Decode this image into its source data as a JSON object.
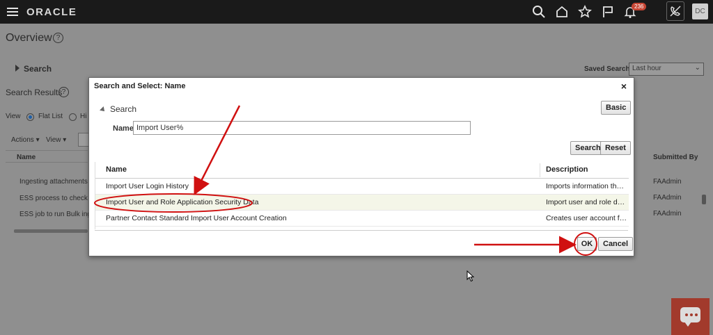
{
  "header": {
    "brand": "ORACLE",
    "notification_count": "236",
    "user_initials": "DC",
    "icons": [
      "menu-icon",
      "search-icon",
      "home-icon",
      "star-icon",
      "flag-icon",
      "bell-icon",
      "phone-off-icon"
    ]
  },
  "page": {
    "title": "Overview",
    "search_section": "Search",
    "saved_search_label": "Saved Search",
    "saved_search_value": "Last hour",
    "results_title": "Search Results",
    "view_label": "View",
    "flat_list": "Flat List",
    "hierarchy_partial": "Hi",
    "actions": "Actions",
    "view_menu": "View",
    "col_name": "Name",
    "col_submitted_by": "Submitted By",
    "rows": [
      {
        "name": "Ingesting attachments fo",
        "submitted_by": "FAAdmin"
      },
      {
        "name": "ESS process to check S",
        "submitted_by": "FAAdmin"
      },
      {
        "name": "ESS job to run Bulk inge",
        "submitted_by": "FAAdmin"
      }
    ]
  },
  "dialog": {
    "title": "Search and Select: Name",
    "search_header": "Search",
    "basic_button": "Basic",
    "name_label": "Name",
    "name_value": "Import User%",
    "search_button": "Search",
    "reset_button": "Reset",
    "columns": {
      "name": "Name",
      "description": "Description"
    },
    "rows": [
      {
        "name": "Import User Login History",
        "description": "Imports information that t..."
      },
      {
        "name": "Import User and Role Application Security Data",
        "description": "Import user and role data ..."
      },
      {
        "name": "Partner Contact Standard Import User Account Creation",
        "description": "Creates user account for ..."
      }
    ],
    "ok_button": "OK",
    "cancel_button": "Cancel"
  },
  "colors": {
    "accent_red": "#d01010",
    "selected_row": "#f4f6e8",
    "topbar": "#1a1a1a"
  }
}
